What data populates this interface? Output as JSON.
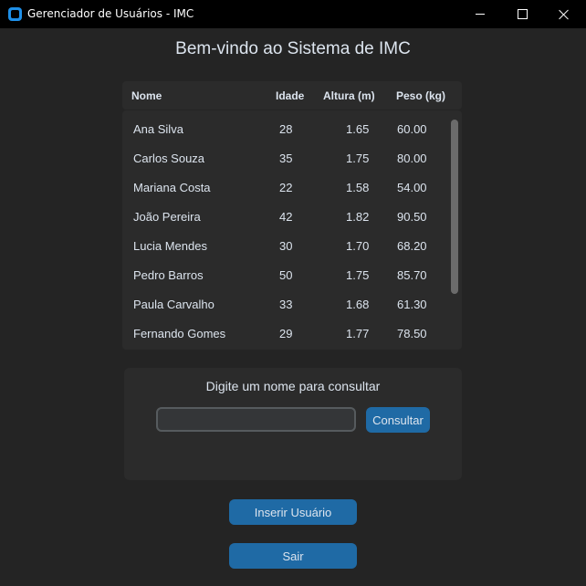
{
  "window": {
    "title": "Gerenciador de Usuários - IMC",
    "icon": "app-icon",
    "controls": [
      "minimize-icon",
      "maximize-icon",
      "close-icon"
    ]
  },
  "heading": "Bem-vindo ao Sistema de IMC",
  "table": {
    "columns": [
      "Nome",
      "Idade",
      "Altura (m)",
      "Peso (kg)"
    ],
    "rows": [
      {
        "nome": "Ana Silva",
        "idade": "28",
        "altura": "1.65",
        "peso": "60.00"
      },
      {
        "nome": "Carlos Souza",
        "idade": "35",
        "altura": "1.75",
        "peso": "80.00"
      },
      {
        "nome": "Mariana Costa",
        "idade": "22",
        "altura": "1.58",
        "peso": "54.00"
      },
      {
        "nome": "João Pereira",
        "idade": "42",
        "altura": "1.82",
        "peso": "90.50"
      },
      {
        "nome": "Lucia Mendes",
        "idade": "30",
        "altura": "1.70",
        "peso": "68.20"
      },
      {
        "nome": "Pedro Barros",
        "idade": "50",
        "altura": "1.75",
        "peso": "85.70"
      },
      {
        "nome": "Paula Carvalho",
        "idade": "33",
        "altura": "1.68",
        "peso": "61.30"
      },
      {
        "nome": "Fernando Gomes",
        "idade": "29",
        "altura": "1.77",
        "peso": "78.50"
      }
    ]
  },
  "search": {
    "label": "Digite um nome para consultar",
    "value": "",
    "placeholder": "",
    "button_label": "Consultar"
  },
  "actions": {
    "insert_label": "Inserir Usuário",
    "exit_label": "Sair"
  },
  "colors": {
    "background": "#242424",
    "panel": "#2b2b2b",
    "accent": "#1f6aa5",
    "titlebar": "#000000"
  }
}
